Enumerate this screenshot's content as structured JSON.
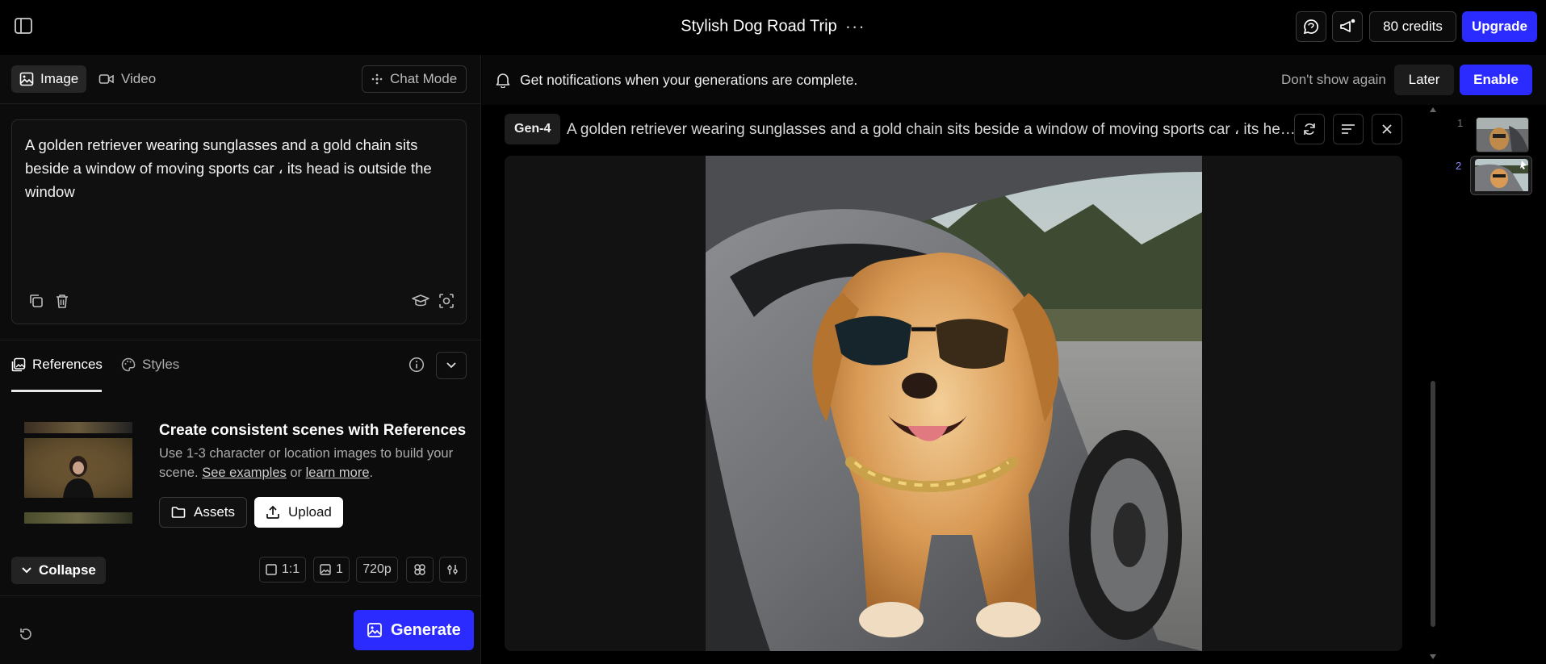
{
  "header": {
    "title": "Stylish Dog Road Trip",
    "more_label": "···",
    "credits_label": "80 credits",
    "upgrade_label": "Upgrade"
  },
  "mode_tabs": {
    "image_label": "Image",
    "video_label": "Video",
    "chat_mode_label": "Chat Mode"
  },
  "prompt": {
    "text": "A golden retriever wearing sunglasses and a gold chain sits beside  a  window of moving sports car ، its head is outside the window"
  },
  "references": {
    "tab_references": "References",
    "tab_styles": "Styles",
    "heading": "Create consistent scenes with References",
    "body_prefix": "Use 1-3 character or location images to build your scene.",
    "see_examples": "See examples",
    "or": "or",
    "learn_more": "learn more",
    "period": ".",
    "assets_label": "Assets",
    "upload_label": "Upload"
  },
  "settings": {
    "collapse_label": "Collapse",
    "aspect_ratio": "1:1",
    "image_count": "1",
    "resolution": "720p"
  },
  "generate_label": "Generate",
  "notification": {
    "message": "Get notifications when your generations are complete.",
    "dont_show_label": "Don't show again",
    "later_label": "Later",
    "enable_label": "Enable"
  },
  "generation": {
    "model_tag": "Gen-4",
    "prompt_preview": "A golden retriever wearing sunglasses and a gold chain sits beside a window of moving sports car ، its head is outside the window"
  },
  "history": [
    {
      "index": "1"
    },
    {
      "index": "2"
    }
  ],
  "colors": {
    "accent": "#2b2bff",
    "background": "#000000",
    "panel": "#0c0c0c"
  }
}
